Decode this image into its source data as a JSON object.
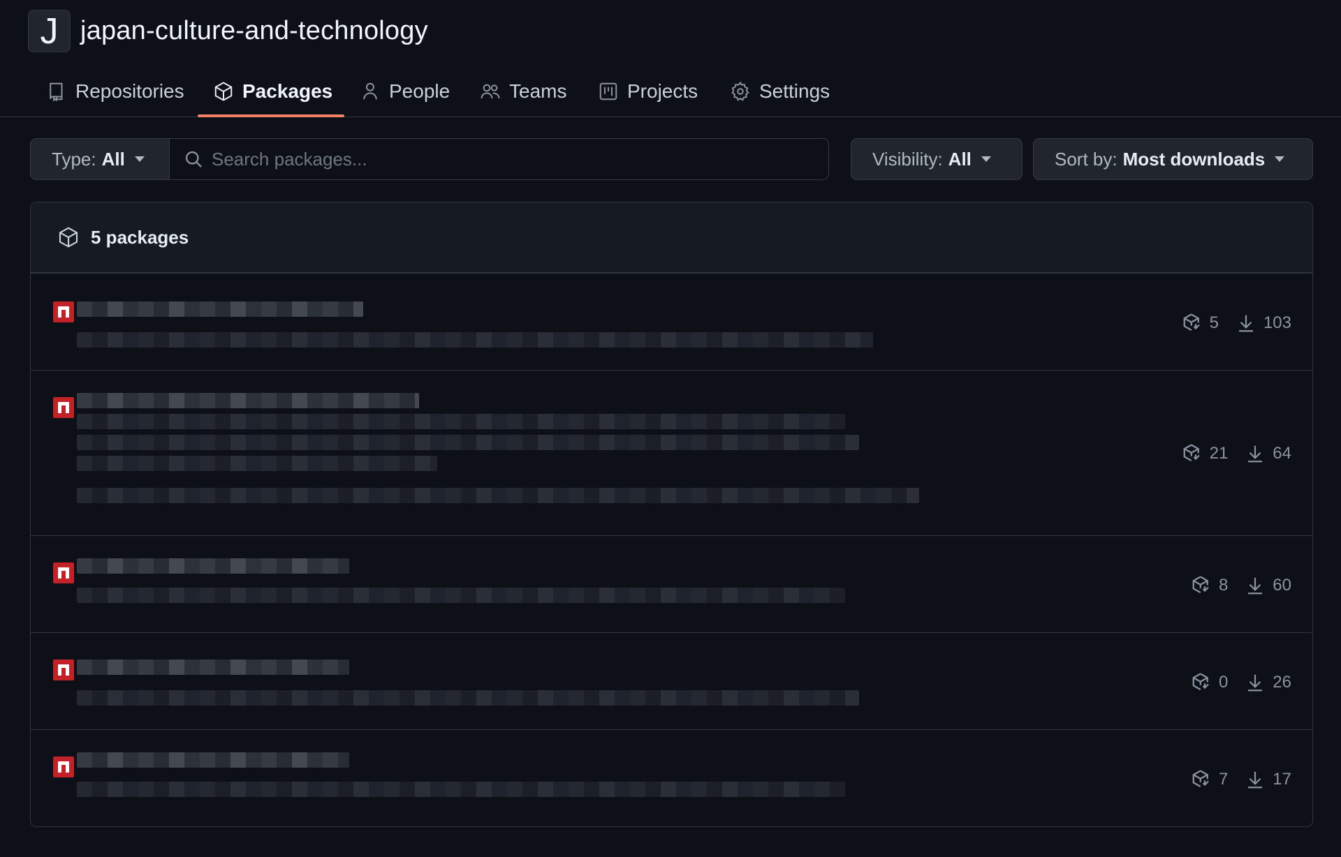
{
  "org": {
    "avatar_letter": "J",
    "name": "japan-culture-and-technology"
  },
  "tabs": [
    {
      "label": "Repositories",
      "icon": "repo-icon",
      "active": false
    },
    {
      "label": "Packages",
      "icon": "package-icon",
      "active": true
    },
    {
      "label": "People",
      "icon": "person-icon",
      "active": false
    },
    {
      "label": "Teams",
      "icon": "people-icon",
      "active": false
    },
    {
      "label": "Projects",
      "icon": "project-icon",
      "active": false
    },
    {
      "label": "Settings",
      "icon": "gear-icon",
      "active": false
    }
  ],
  "filters": {
    "type_label": "Type:",
    "type_value": "All",
    "search_placeholder": "Search packages...",
    "visibility_label": "Visibility:",
    "visibility_value": "All",
    "sort_label": "Sort by:",
    "sort_value": "Most downloads"
  },
  "packages_header": "5 packages",
  "packages": [
    {
      "icon": "npm-icon",
      "versions": "5",
      "downloads": "103"
    },
    {
      "icon": "npm-icon",
      "versions": "21",
      "downloads": "64"
    },
    {
      "icon": "npm-icon",
      "versions": "8",
      "downloads": "60"
    },
    {
      "icon": "npm-icon",
      "versions": "0",
      "downloads": "26"
    },
    {
      "icon": "npm-icon",
      "versions": "7",
      "downloads": "17"
    }
  ],
  "colors": {
    "background": "#0d1117",
    "accent_underline": "#f78166",
    "npm_red": "#c12127"
  }
}
